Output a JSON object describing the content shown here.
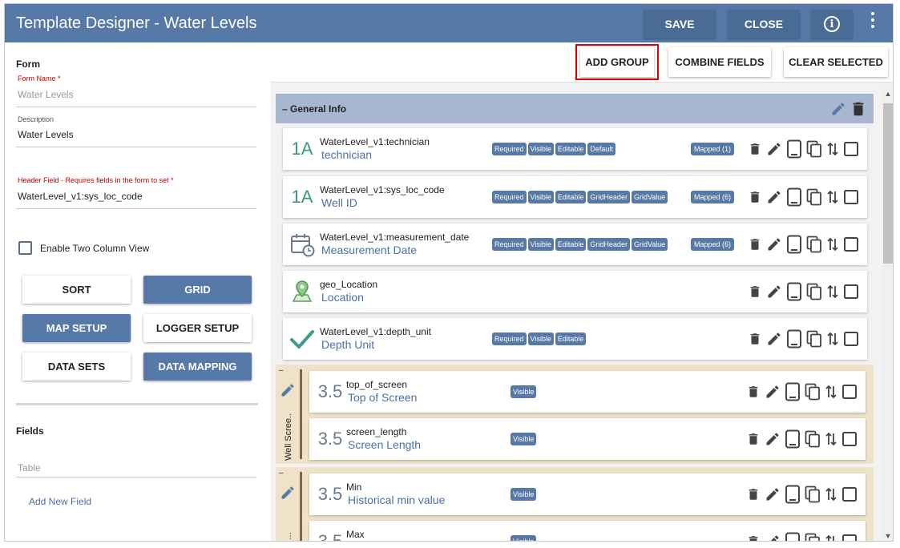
{
  "header": {
    "title": "Template Designer - Water Levels",
    "save_label": "SAVE",
    "close_label": "CLOSE",
    "info_glyph": "i"
  },
  "form": {
    "section_title": "Form",
    "form_name_label": "Form Name *",
    "form_name_value": "Water Levels",
    "description_label": "Description",
    "description_value": "Water Levels",
    "header_field_label": "Header Field - Requires fields in the form to set *",
    "header_field_value": "WaterLevel_v1:sys_loc_code",
    "two_column_label": "Enable Two Column View",
    "buttons": {
      "sort": "SORT",
      "grid": "GRID",
      "map_setup": "MAP SETUP",
      "logger_setup": "LOGGER SETUP",
      "data_sets": "DATA SETS",
      "data_mapping": "DATA MAPPING"
    },
    "fields_title": "Fields",
    "table_value": "Table",
    "add_new_field": "Add New Field"
  },
  "toolbar": {
    "add_group": "ADD GROUP",
    "combine_fields": "COMBINE FIELDS",
    "clear_selected": "CLEAR SELECTED"
  },
  "group": {
    "title": "– General Info"
  },
  "fields": [
    {
      "icon": "1A",
      "name": "WaterLevel_v1:technician",
      "label": "technician",
      "badges": [
        "Required",
        "Visible",
        "Editable",
        "Default"
      ],
      "mapped": "Mapped  (1)"
    },
    {
      "icon": "1A",
      "name": "WaterLevel_v1:sys_loc_code",
      "label": "Well ID",
      "badges": [
        "Required",
        "Visible",
        "Editable",
        "GridHeader",
        "GridValue"
      ],
      "mapped": "Mapped  (6)"
    },
    {
      "icon": "calendar-icon",
      "name": "WaterLevel_v1:measurement_date",
      "label": "Measurement Date",
      "badges": [
        "Required",
        "Visible",
        "Editable",
        "GridHeader",
        "GridValue"
      ],
      "mapped": "Mapped  (6)"
    },
    {
      "icon": "map-pin-icon",
      "name": "geo_Location",
      "label": "Location",
      "badges": [],
      "mapped": ""
    },
    {
      "icon": "checkmark-icon",
      "name": "WaterLevel_v1:depth_unit",
      "label": "Depth Unit",
      "badges": [
        "Required",
        "Visible",
        "Editable"
      ],
      "mapped": ""
    }
  ],
  "subgroups": [
    {
      "mini": "–",
      "name": "Well Scree...",
      "items": [
        {
          "icon": "3.5",
          "name": "top_of_screen",
          "label": "Top of Screen",
          "badges": [
            "Visible"
          ]
        },
        {
          "icon": "3.5",
          "name": "screen_length",
          "label": "Screen Length",
          "badges": [
            "Visible"
          ]
        }
      ]
    },
    {
      "mini": "–",
      "name": "orical ...",
      "items": [
        {
          "icon": "3.5",
          "name": "Min",
          "label": "Historical min value",
          "badges": [
            "Visible"
          ]
        },
        {
          "icon": "3.5",
          "name": "Max",
          "label": "",
          "badges": [
            "Visible"
          ]
        }
      ]
    }
  ],
  "colors": {
    "header_bg": "#5679a8",
    "group_header_bg": "#a6b7cf",
    "subgroup_bg": "#f0e2c8",
    "badge_bg": "#5679a8",
    "label_blue": "#4a72a8",
    "highlight_red": "#dd0000"
  }
}
